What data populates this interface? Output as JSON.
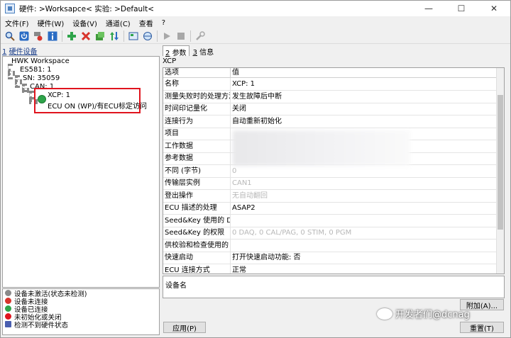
{
  "window": {
    "title": "硬件: >Worksapce<  实验: >Default<",
    "minimize": "—",
    "maximize": "☐",
    "close": "✕"
  },
  "menu": [
    "文件(F)",
    "硬件(W)",
    "设备(V)",
    "通道(C)",
    "查看",
    "?"
  ],
  "toolbar": {
    "icons": [
      "search-icon",
      "power-icon",
      "device-add-icon",
      "info-icon",
      "add-icon",
      "delete-icon",
      "module-icon",
      "sort-icon",
      "config-icon",
      "network-icon",
      "play-icon",
      "stop-icon",
      "wrench-icon"
    ]
  },
  "left": {
    "header_num": "1",
    "header_label": "硬件设备",
    "tree": {
      "root": "HWK Workspace",
      "es": "ES581: 1",
      "sn": "SN: 35059",
      "can": "CAN: 1",
      "xcp": "XCP: 1",
      "ecu": "ECU ON (WP)/有ECU标定访问"
    },
    "legend": [
      {
        "label": "设备未激活(状态未检测)",
        "color": "#8a8a8a"
      },
      {
        "label": "设备未连接",
        "color": "#d8342c"
      },
      {
        "label": "设备已连接",
        "color": "#2ea44a"
      },
      {
        "label": "未初始化或关闭",
        "color": "#e0141e"
      },
      {
        "label": "检测不到硬件状态",
        "color": "#4a5fb0"
      }
    ]
  },
  "right": {
    "tabs": [
      {
        "num": "2",
        "label": "参数",
        "active": true
      },
      {
        "num": "3",
        "label": "信息",
        "active": false
      }
    ],
    "section_title": "XCP",
    "columns": [
      "选项",
      "值"
    ],
    "rows": [
      {
        "name": "名称",
        "value": "XCP: 1",
        "grey": false
      },
      {
        "name": "测量失败时的处理方法",
        "value": "发生故障后中断",
        "grey": false
      },
      {
        "name": "时间印记量化",
        "value": "关闭",
        "grey": false
      },
      {
        "name": "连接行为",
        "value": "自动重新初始化",
        "grey": false
      },
      {
        "name": "项目",
        "value": "",
        "grey": false
      },
      {
        "name": "工作数据",
        "value": "",
        "grey": false
      },
      {
        "name": "参考数据",
        "value": "",
        "grey": false
      },
      {
        "name": "不同 (字节)",
        "value": "0",
        "grey": true
      },
      {
        "name": "传输层实例",
        "value": "CAN1",
        "grey": true
      },
      {
        "name": "登出操作",
        "value": "无自动翻回",
        "grey": true
      },
      {
        "name": "ECU 描述的处理",
        "value": "ASAP2",
        "grey": false
      },
      {
        "name": "Seed&Key 使用的 DLL",
        "value": "",
        "grey": false
      },
      {
        "name": "Seed&Key 的权限",
        "value": "0 DAQ, 0 CAL/PAG, 0 STIM, 0 PGM",
        "grey": true
      },
      {
        "name": "供校验和检查使用的 DLL",
        "value": "",
        "grey": false
      },
      {
        "name": "快速启动",
        "value": "打开快速启动功能: 否",
        "grey": false
      },
      {
        "name": "ECU 连接方式",
        "value": "正常",
        "grey": false
      }
    ],
    "description_label": "设备名",
    "attach_button": "附加(A)...",
    "apply_button": "应用(P)",
    "reset_button": "重置(T)"
  },
  "watermark": "开发者们@dcnag"
}
